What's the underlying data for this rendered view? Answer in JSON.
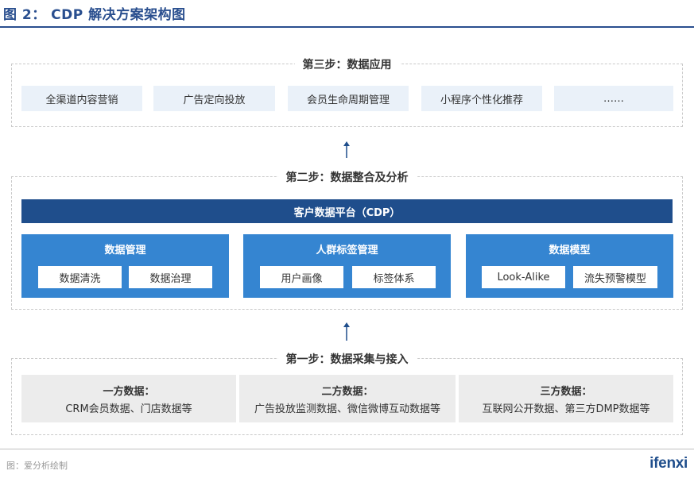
{
  "header": {
    "title": "图 2： CDP 解决方案架构图"
  },
  "step3": {
    "label": "第三步：数据应用",
    "items": [
      "全渠道内容营销",
      "广告定向投放",
      "会员生命周期管理",
      "小程序个性化推荐",
      "……"
    ]
  },
  "step2": {
    "label": "第二步：数据整合及分析",
    "platform": "客户数据平台（CDP）",
    "modules": [
      {
        "title": "数据管理",
        "items": [
          "数据清洗",
          "数据治理"
        ]
      },
      {
        "title": "人群标签管理",
        "items": [
          "用户画像",
          "标签体系"
        ]
      },
      {
        "title": "数据模型",
        "items": [
          "Look-Alike",
          "流失预警模型"
        ]
      }
    ]
  },
  "step1": {
    "label": "第一步：数据采集与接入",
    "sources": [
      {
        "title": "一方数据：",
        "desc": "CRM会员数据、门店数据等"
      },
      {
        "title": "二方数据：",
        "desc": "广告投放监测数据、微信微博互动数据等"
      },
      {
        "title": "三方数据：",
        "desc": "互联网公开数据、第三方DMP数据等"
      }
    ]
  },
  "footer": {
    "source": "图：爱分析绘制",
    "logo": "ifenxi"
  },
  "colors": {
    "navy": "#1f4e8c",
    "blue": "#3585d1",
    "light_blue": "#eaf1f9",
    "gray": "#ececec"
  }
}
